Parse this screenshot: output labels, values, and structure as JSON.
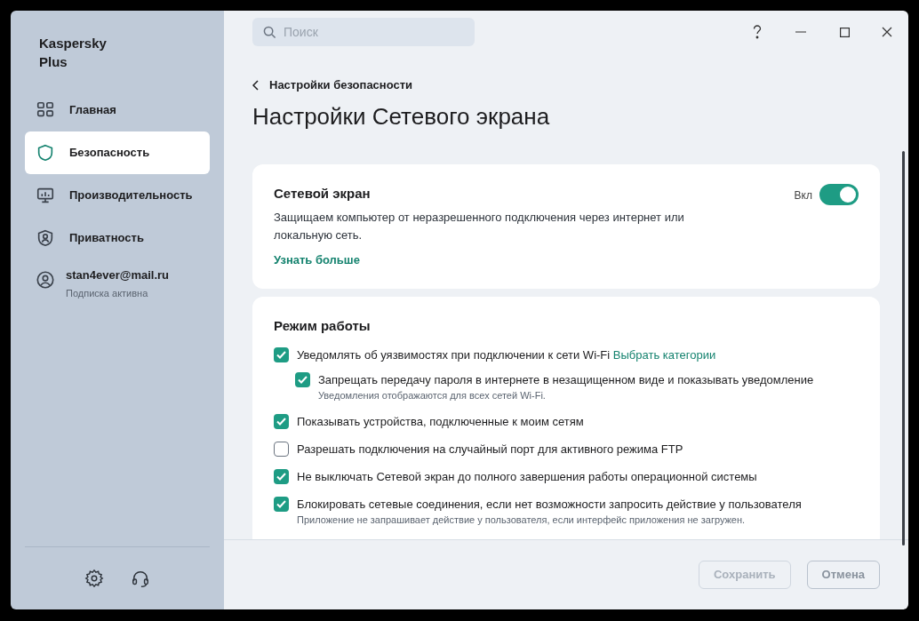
{
  "app": {
    "name_line1": "Kaspersky",
    "name_line2": "Plus"
  },
  "sidebar": {
    "items": [
      {
        "label": "Главная",
        "selected": false
      },
      {
        "label": "Безопасность",
        "selected": true
      },
      {
        "label": "Производительность",
        "selected": false
      },
      {
        "label": "Приватность",
        "selected": false
      }
    ],
    "account": {
      "email": "stan4ever@mail.ru",
      "status": "Подписка активна"
    }
  },
  "search": {
    "placeholder": "Поиск"
  },
  "breadcrumb": "Настройки безопасности",
  "page_title": "Настройки Сетевого экрана",
  "firewall_card": {
    "title": "Сетевой экран",
    "toggle_label": "Вкл",
    "on": true,
    "description": "Защищаем компьютер от неразрешенного подключения через интернет или локальную сеть.",
    "link": "Узнать больше"
  },
  "mode_card": {
    "title": "Режим работы",
    "options": [
      {
        "label": "Уведомлять об уязвимостях при подключении к сети Wi-Fi",
        "link": "Выбрать категории",
        "checked": true,
        "children": [
          {
            "label": "Запрещать передачу пароля в интернете в незащищенном виде и показывать уведомление",
            "note": "Уведомления отображаются для всех сетей Wi-Fi.",
            "checked": true
          }
        ]
      },
      {
        "label": "Показывать устройства, подключенные к моим сетям",
        "checked": true
      },
      {
        "label": "Разрешать подключения на случайный порт для активного режима FTP",
        "checked": false
      },
      {
        "label": "Не выключать Сетевой экран до полного завершения работы операционной системы",
        "checked": true
      },
      {
        "label": "Блокировать сетевые соединения, если нет возможности запросить действие у пользователя",
        "note": "Приложение не запрашивает действие у пользователя, если интерфейс приложения не загружен.",
        "checked": true
      }
    ]
  },
  "footer": {
    "buttons": [
      {
        "label": "Сохранить",
        "disabled": true
      },
      {
        "label": "Отмена",
        "disabled": false
      }
    ]
  }
}
